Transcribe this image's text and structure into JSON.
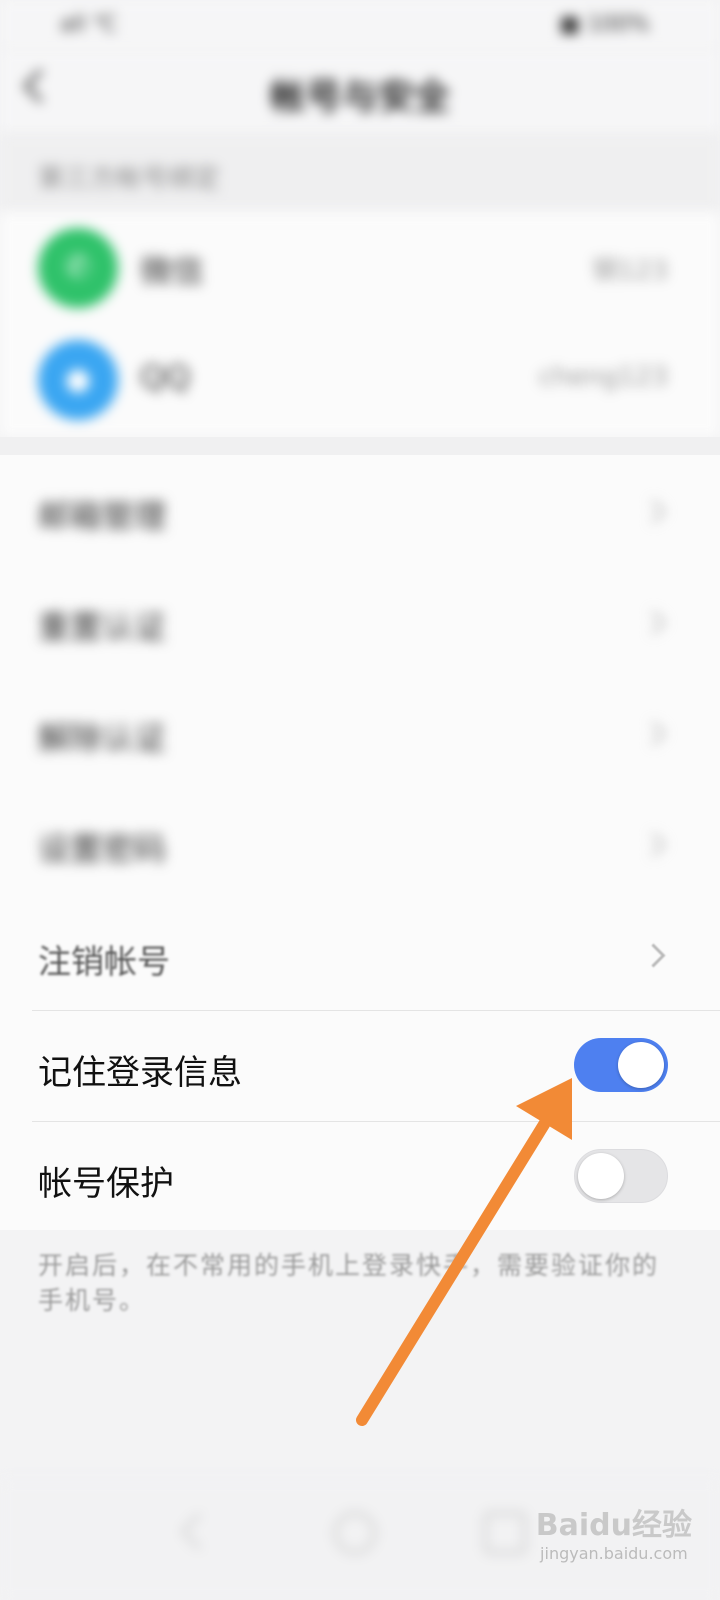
{
  "status_bar": {
    "left": "all ℃",
    "right": "■ 100%"
  },
  "nav": {
    "title": "帐号与安全"
  },
  "linked_section": {
    "header": "第三方帐号绑定",
    "accounts": [
      {
        "label": "微信",
        "value": "钢123",
        "icon": "wechat-icon",
        "color": "#2fc26a",
        "glyph": "✆"
      },
      {
        "label": "QQ",
        "value": "cheng123",
        "icon": "qq-icon",
        "color": "#3aa6f2",
        "glyph": "●"
      }
    ]
  },
  "menu": {
    "items": [
      {
        "label": "邮箱管理"
      },
      {
        "label": "重置认证"
      },
      {
        "label": "解除认证"
      },
      {
        "label": "设置密码"
      },
      {
        "label": "注销帐号"
      }
    ],
    "toggles": [
      {
        "label": "记住登录信息",
        "state": "on"
      },
      {
        "label": "帐号保护",
        "state": "off"
      }
    ]
  },
  "footnote": "开启后，在不常用的手机上登录快手，需要验证你的手机号。",
  "watermark": {
    "main": "Baidu经验",
    "sub": "jingyan.baidu.com"
  },
  "colors": {
    "toggle_on": "#4e80f0",
    "annotation_arrow": "#f28a36"
  }
}
